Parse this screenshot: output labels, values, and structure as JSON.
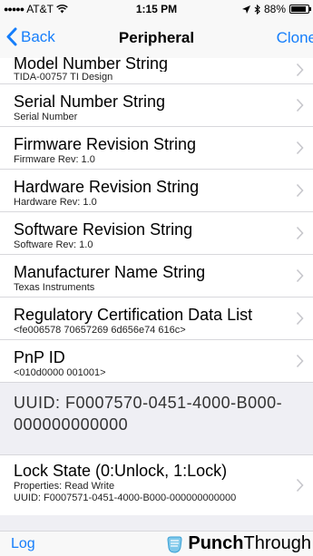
{
  "status_bar": {
    "carrier": "AT&T",
    "time": "1:15 PM",
    "battery": "88%",
    "battery_level": 0.88
  },
  "nav": {
    "back_label": "Back",
    "title": "Peripheral",
    "right_label": "Clone"
  },
  "rows": [
    {
      "title": "Model Number String",
      "subtitle": "TIDA-00757 TI Design"
    },
    {
      "title": "Serial Number String",
      "subtitle": "Serial Number"
    },
    {
      "title": "Firmware Revision String",
      "subtitle": "Firmware Rev: 1.0"
    },
    {
      "title": "Hardware Revision String",
      "subtitle": "Hardware Rev: 1.0"
    },
    {
      "title": "Software Revision String",
      "subtitle": "Software Rev: 1.0"
    },
    {
      "title": "Manufacturer Name String",
      "subtitle": "Texas Instruments"
    },
    {
      "title": "Regulatory Certification Data List",
      "subtitle": "<fe006578 70657269 6d656e74 616c>"
    },
    {
      "title": "PnP ID",
      "subtitle": "<010d0000 001001>"
    }
  ],
  "section": {
    "header": "UUID: F0007570-0451-4000-B000-000000000000",
    "rows": [
      {
        "title": "Lock State (0:Unlock, 1:Lock)",
        "properties": "Properties: Read Write",
        "uuid": "UUID: F0007571-0451-4000-B000-000000000000"
      }
    ]
  },
  "footer": {
    "log_label": "Log",
    "brand_bold": "Punch",
    "brand_regular": "Through"
  },
  "colors": {
    "accent": "#157efb",
    "group_background": "#efeff4"
  },
  "icons": [
    "signal-dots-icon",
    "wifi-icon",
    "location-arrow-icon",
    "bluetooth-icon",
    "battery-icon",
    "back-chevron-icon",
    "chevron-right-icon",
    "punchthrough-logo-icon"
  ]
}
